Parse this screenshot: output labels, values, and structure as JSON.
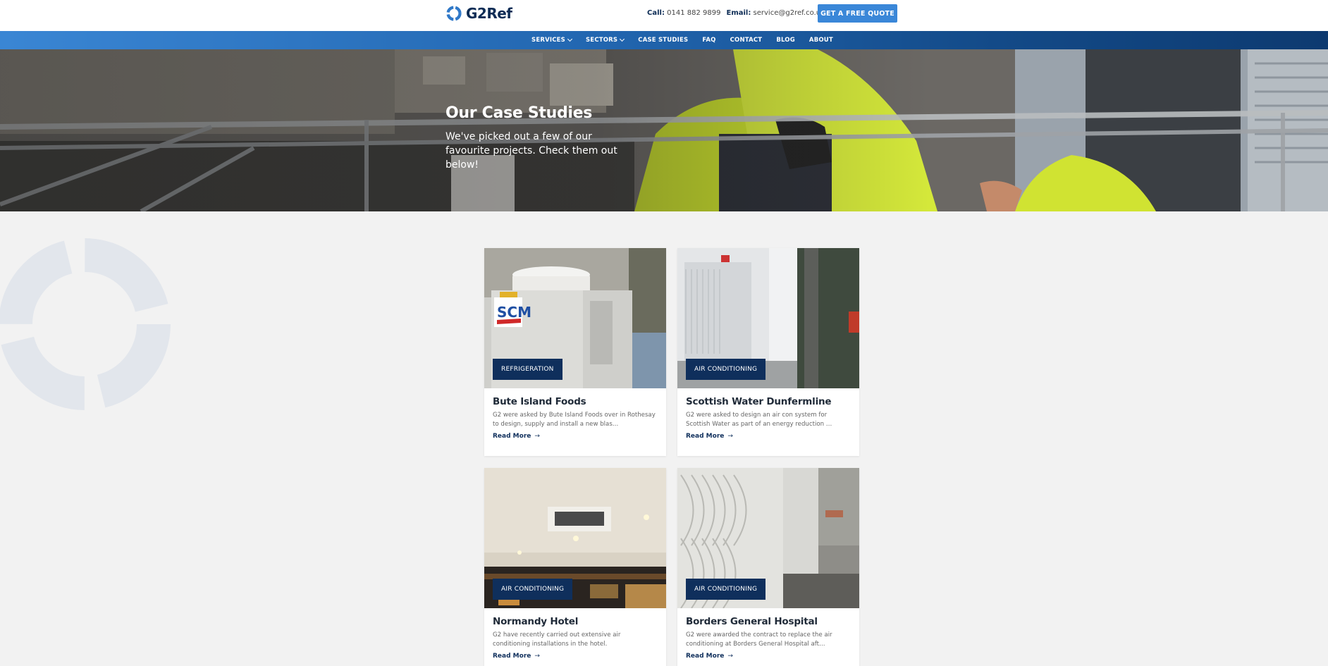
{
  "brand": {
    "logo_text": "G2Ref",
    "primary": "#0d2c55",
    "accent": "#3a87d8"
  },
  "header": {
    "call_label": "Call:",
    "call_value": "0141 882 9899",
    "email_label": "Email:",
    "email_value": "service@g2ref.co.uk",
    "quote_button": "GET A FREE QUOTE"
  },
  "nav": {
    "items": [
      {
        "label": "SERVICES",
        "dropdown": true
      },
      {
        "label": "SECTORS",
        "dropdown": true
      },
      {
        "label": "CASE STUDIES",
        "dropdown": false
      },
      {
        "label": "FAQ",
        "dropdown": false
      },
      {
        "label": "CONTACT",
        "dropdown": false
      },
      {
        "label": "BLOG",
        "dropdown": false
      },
      {
        "label": "ABOUT",
        "dropdown": false
      }
    ]
  },
  "hero": {
    "title": "Our Case Studies",
    "subtitle": "We've picked out a few of our favourite projects. Check them out below!"
  },
  "cards": [
    {
      "tag": "REFRIGERATION",
      "title": "Bute Island Foods",
      "excerpt": "G2 were asked by Bute Island Foods over in Rothesay to design, supply and install a new blas…",
      "read_more": "Read More"
    },
    {
      "tag": "AIR CONDITIONING",
      "title": "Scottish Water Dunfermline",
      "excerpt": "G2 were asked to design an air con system for Scottish Water as part of an energy reduction …",
      "read_more": "Read More"
    },
    {
      "tag": "AIR CONDITIONING",
      "title": "Normandy Hotel",
      "excerpt": "G2 have recently carried out extensive air conditioning installations in the hotel.",
      "read_more": "Read More"
    },
    {
      "tag": "AIR CONDITIONING",
      "title": "Borders General Hospital",
      "excerpt": "G2 were awarded the contract to replace the air conditioning at Borders General Hospital aft…",
      "read_more": "Read More"
    }
  ],
  "icons": {
    "logo": "g2-logo-icon",
    "chevron": "chevron-down-icon",
    "arrow": "arrow-right-icon"
  }
}
